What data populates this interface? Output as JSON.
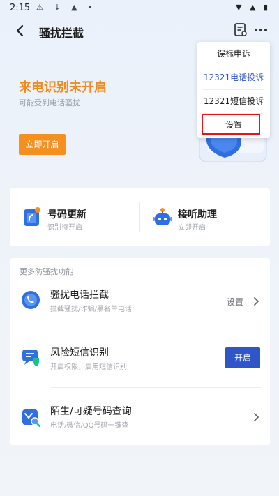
{
  "status_bar": {
    "time": "2:15"
  },
  "header": {
    "title": "骚扰拦截"
  },
  "hero": {
    "title": "来电识别未开启",
    "subtitle": "可能受到电话骚扰",
    "button_label": "立即开启"
  },
  "menu": {
    "items": [
      {
        "label": "误标申诉"
      },
      {
        "label": "12321电话投诉"
      },
      {
        "label": "12321短信投诉"
      },
      {
        "label": "设置"
      }
    ]
  },
  "quick_actions": [
    {
      "name": "号码更新",
      "desc": "识别待开启"
    },
    {
      "name": "接听助理",
      "desc": "立即开启"
    }
  ],
  "more_section": {
    "title": "更多防骚扰功能",
    "rows": [
      {
        "name": "骚扰电话拦截",
        "desc": "拦截骚扰/诈骗/黑名单电话",
        "action": "设置"
      },
      {
        "name": "风险短信识别",
        "desc": "开启权限，启用短信识别",
        "button": "开启"
      },
      {
        "name": "陌生/可疑号码查询",
        "desc": "电话/微信/QQ号码一键查"
      }
    ]
  },
  "colors": {
    "accent_orange": "#f5901f",
    "primary_blue": "#2f56c9",
    "highlight_red": "#e5141b"
  }
}
